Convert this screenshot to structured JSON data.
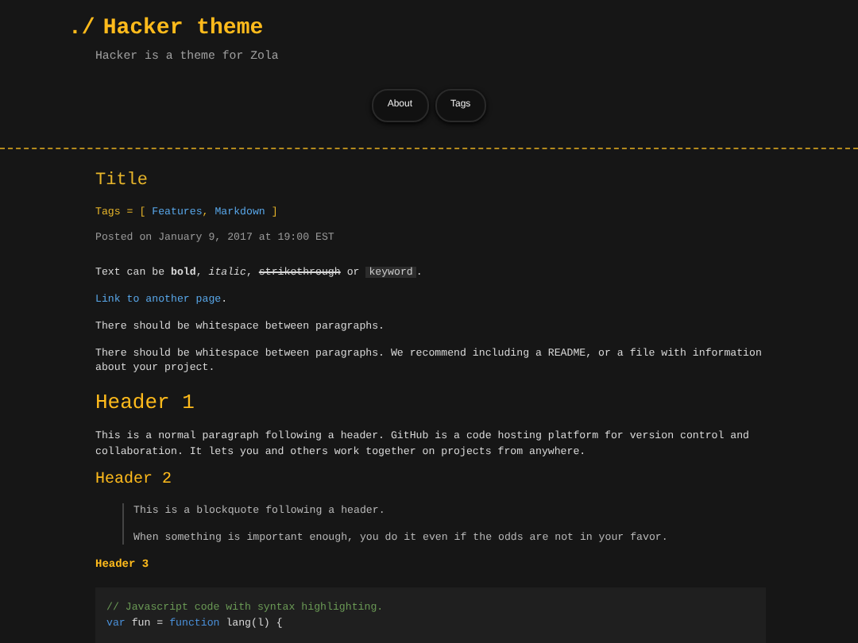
{
  "site": {
    "prompt": "./",
    "title": "Hacker theme",
    "tagline": "Hacker is a theme for Zola"
  },
  "nav": [
    {
      "label": "About"
    },
    {
      "label": "Tags"
    }
  ],
  "post": {
    "title": "Title",
    "tags_prefix": "Tags = [",
    "tags": [
      "Features",
      "Markdown"
    ],
    "tags_separator": ",",
    "tags_suffix": "]",
    "meta": "Posted on January 9, 2017 at 19:00 EST"
  },
  "content": [
    {
      "kind": "paragraph",
      "segments": [
        {
          "kind": "text",
          "text": "Text can be "
        },
        {
          "kind": "bold",
          "text": "bold"
        },
        {
          "kind": "text",
          "text": ", "
        },
        {
          "kind": "italic",
          "text": "italic"
        },
        {
          "kind": "text",
          "text": ", "
        },
        {
          "kind": "strike",
          "text": "strikethrough"
        },
        {
          "kind": "text",
          "text": " or "
        },
        {
          "kind": "code",
          "text": "keyword"
        },
        {
          "kind": "text",
          "text": "."
        }
      ]
    },
    {
      "kind": "link",
      "text": "Link to another page",
      "after": "."
    },
    {
      "kind": "paragraph",
      "segments": [
        {
          "kind": "text",
          "text": "There should be whitespace between paragraphs."
        }
      ]
    },
    {
      "kind": "paragraph",
      "segments": [
        {
          "kind": "text",
          "text": "There should be whitespace between paragraphs. We recommend including a README, or a file with information about your project."
        }
      ]
    },
    {
      "kind": "h1",
      "text": "Header 1"
    },
    {
      "kind": "paragraph",
      "segments": [
        {
          "kind": "text",
          "text": "This is a normal paragraph following a header. GitHub is a code hosting platform for version control and collaboration. It lets you and others work together on projects from anywhere."
        }
      ]
    },
    {
      "kind": "h2",
      "text": "Header 2"
    },
    {
      "kind": "quote",
      "lines": [
        "This is a blockquote following a header.",
        "When something is important enough, you do it even if the odds are not in your favor."
      ]
    },
    {
      "kind": "h3",
      "text": "Header 3"
    },
    {
      "kind": "code_block",
      "lines": [
        [
          {
            "kind": "comment",
            "text": "// Javascript code with syntax highlighting."
          }
        ],
        [
          {
            "kind": "keyword",
            "text": "var"
          },
          {
            "kind": "plain",
            "text": " fun = "
          },
          {
            "kind": "keyword",
            "text": "function"
          },
          {
            "kind": "plain",
            "text": " lang(l) {"
          }
        ]
      ]
    }
  ]
}
